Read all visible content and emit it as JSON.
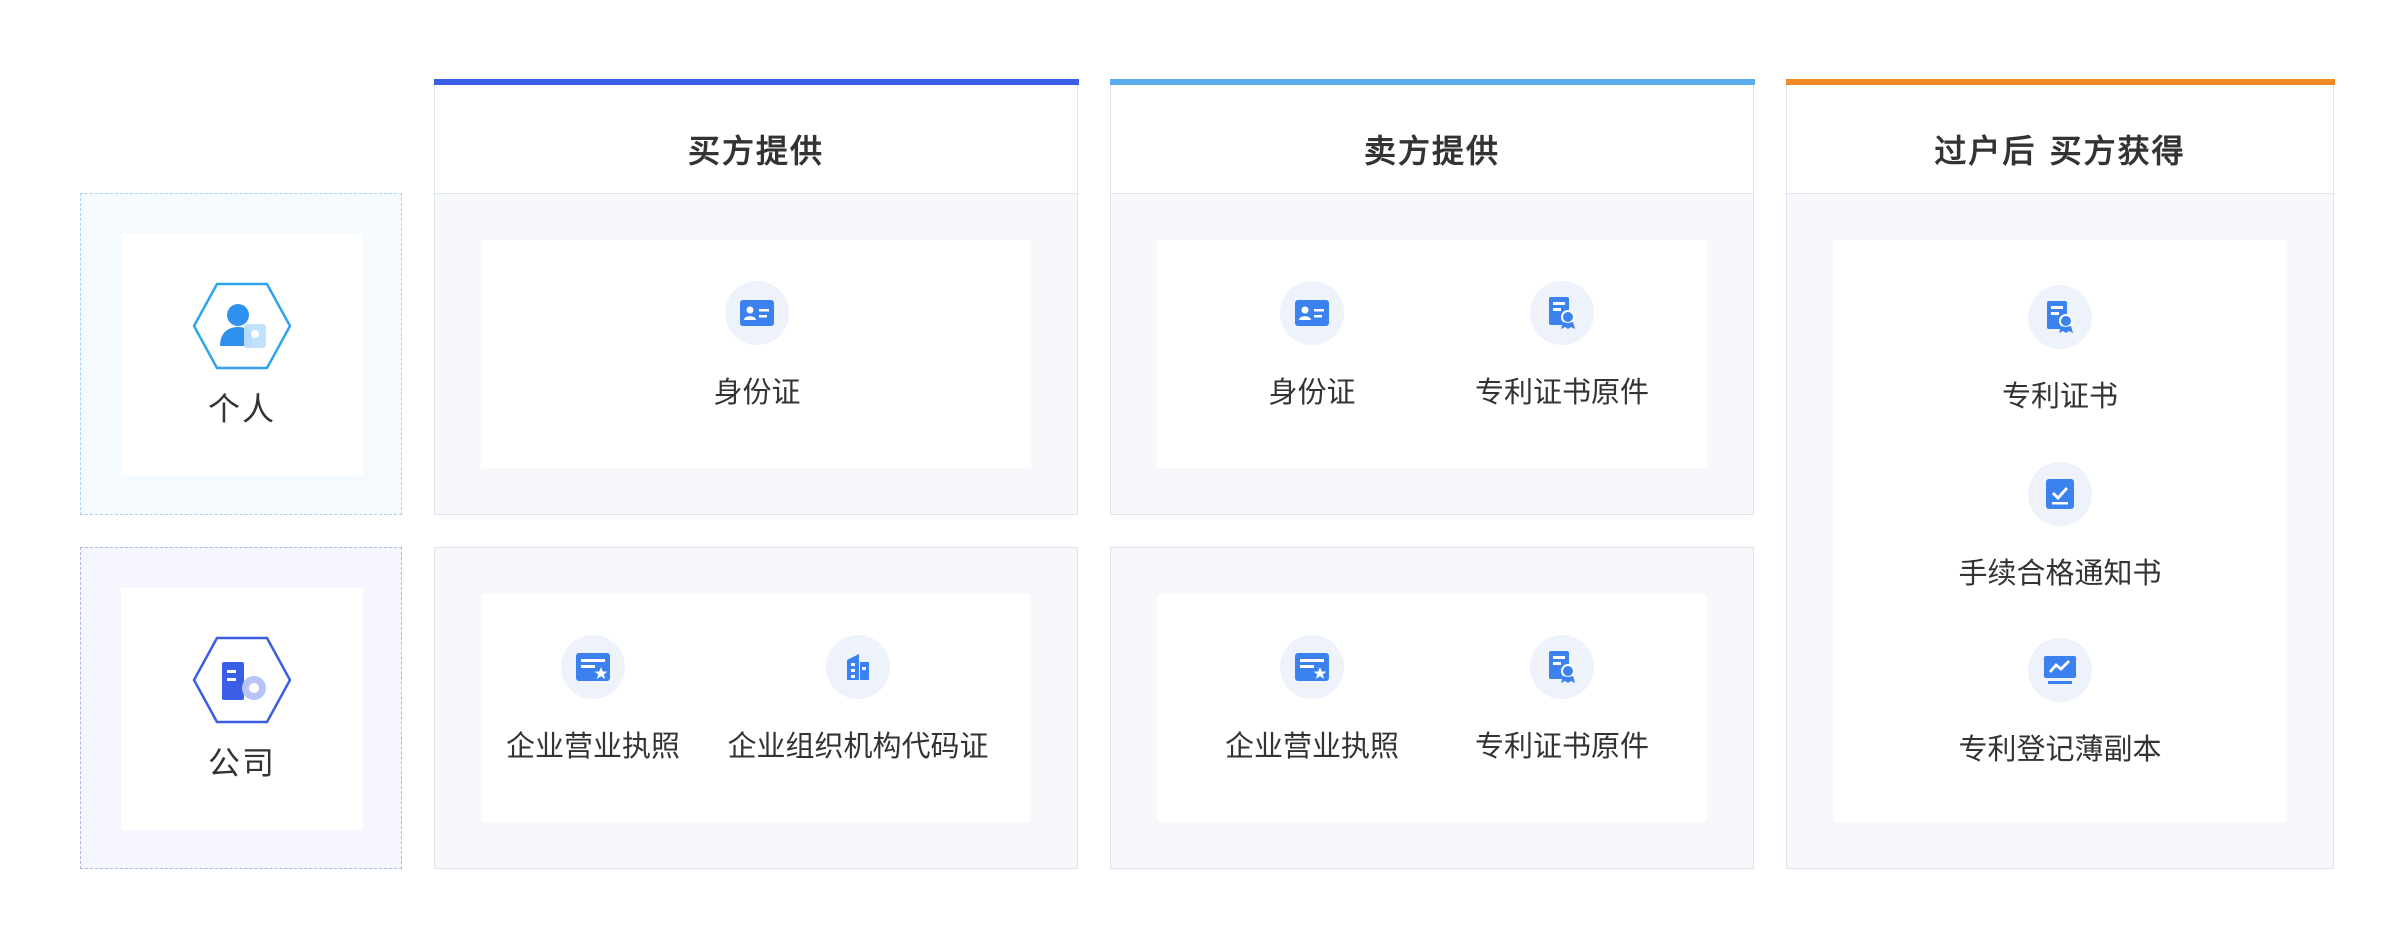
{
  "columns": [
    {
      "title": "买方提供",
      "accent": "#3b5ee6"
    },
    {
      "title": "卖方提供",
      "accent": "#5aaef0"
    },
    {
      "title": "过户后 买方获得",
      "accent": "#f08a24"
    }
  ],
  "rows": {
    "personal": {
      "label": "个人",
      "icon": "person-hexagon-icon"
    },
    "company": {
      "label": "公司",
      "icon": "company-hexagon-icon"
    }
  },
  "buyer": {
    "personal": [
      {
        "label": "身份证",
        "icon": "id-card-icon"
      }
    ],
    "company": [
      {
        "label": "企业营业执照",
        "icon": "business-license-icon"
      },
      {
        "label": "企业组织机构代码证",
        "icon": "organization-building-icon"
      }
    ]
  },
  "seller": {
    "personal": [
      {
        "label": "身份证",
        "icon": "id-card-icon"
      },
      {
        "label": "专利证书原件",
        "icon": "patent-certificate-icon"
      }
    ],
    "company": [
      {
        "label": "企业营业执照",
        "icon": "business-license-icon"
      },
      {
        "label": "专利证书原件",
        "icon": "patent-certificate-icon"
      }
    ]
  },
  "obtained": [
    {
      "label": "专利证书",
      "icon": "patent-certificate-icon"
    },
    {
      "label": "手续合格通知书",
      "icon": "approval-notice-icon"
    },
    {
      "label": "专利登记薄副本",
      "icon": "register-copy-icon"
    }
  ]
}
